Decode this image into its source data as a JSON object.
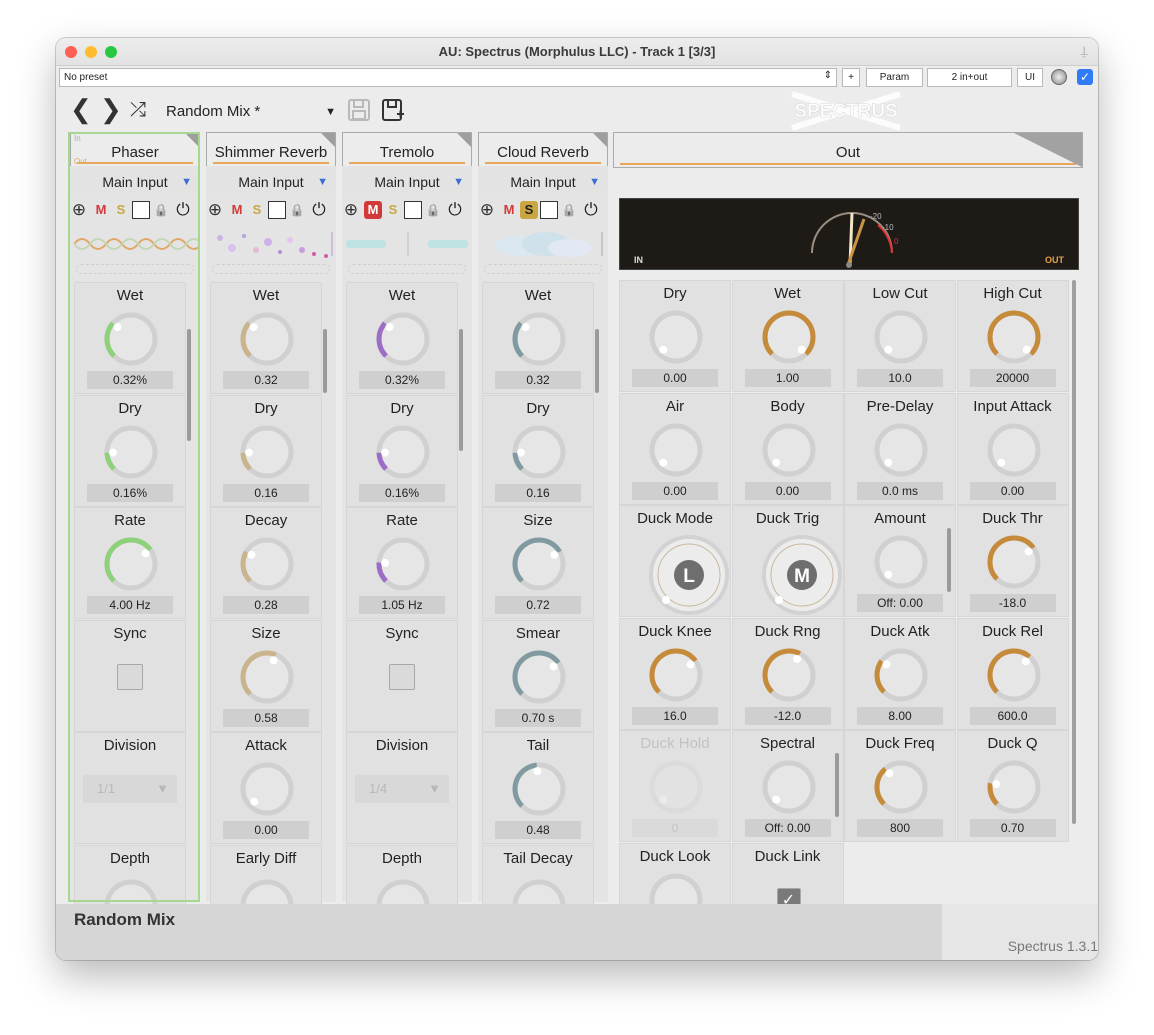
{
  "window": {
    "title": "AU: Spectrus (Morphulus LLC) - Track 1 [3/3]"
  },
  "host": {
    "preset": "No preset",
    "plus": "+",
    "param": "Param",
    "io": "2 in+out",
    "ui": "UI"
  },
  "nav": {
    "preset_name": "Random Mix *",
    "logo": "SPECTRUS"
  },
  "colors": {
    "accent": "#e8a85c",
    "green": "#8fd07a",
    "purple": "#9b6dc6",
    "teal": "#7f9ba1",
    "tan": "#c9b48e",
    "orange": "#c58a3a"
  },
  "effects": [
    {
      "name": "Phaser",
      "input": "Main Input"
    },
    {
      "name": "Shimmer Reverb",
      "input": "Main Input"
    },
    {
      "name": "Tremolo",
      "input": "Main Input"
    },
    {
      "name": "Cloud Reverb",
      "input": "Main Input"
    }
  ],
  "phaser": {
    "in": "In",
    "out": "Out",
    "params": [
      {
        "label": "Wet",
        "value": "0.32%",
        "level": 0.32
      },
      {
        "label": "Dry",
        "value": "0.16%",
        "level": 0.16
      },
      {
        "label": "Rate",
        "value": "4.00 Hz",
        "level": 0.7
      },
      {
        "label": "Sync"
      },
      {
        "label": "Division",
        "value": "1/1"
      },
      {
        "label": "Depth"
      }
    ]
  },
  "shimmer": {
    "params": [
      {
        "label": "Wet",
        "value": "0.32",
        "level": 0.32
      },
      {
        "label": "Dry",
        "value": "0.16",
        "level": 0.16
      },
      {
        "label": "Decay",
        "value": "0.28",
        "level": 0.28
      },
      {
        "label": "Size",
        "value": "0.58",
        "level": 0.58
      },
      {
        "label": "Attack",
        "value": "0.00",
        "level": 0.0
      },
      {
        "label": "Early Diff"
      }
    ]
  },
  "tremolo": {
    "params": [
      {
        "label": "Wet",
        "value": "0.32%",
        "level": 0.32
      },
      {
        "label": "Dry",
        "value": "0.16%",
        "level": 0.16
      },
      {
        "label": "Rate",
        "value": "1.05 Hz",
        "level": 0.18
      },
      {
        "label": "Sync"
      },
      {
        "label": "Division",
        "value": "1/4"
      },
      {
        "label": "Depth"
      }
    ]
  },
  "cloud": {
    "params": [
      {
        "label": "Wet",
        "value": "0.32",
        "level": 0.32
      },
      {
        "label": "Dry",
        "value": "0.16",
        "level": 0.16
      },
      {
        "label": "Size",
        "value": "0.72",
        "level": 0.72
      },
      {
        "label": "Smear",
        "value": "0.70 s",
        "level": 0.7
      },
      {
        "label": "Tail",
        "value": "0.48",
        "level": 0.48
      },
      {
        "label": "Tail Decay"
      }
    ]
  },
  "out": {
    "name": "Out",
    "meter_in": "IN",
    "meter_out": "OUT",
    "meter_marks": [
      "-20",
      "-10",
      "0"
    ],
    "params": [
      {
        "label": "Dry",
        "value": "0.00",
        "level": 0.0
      },
      {
        "label": "Wet",
        "value": "1.00",
        "level": 1.0
      },
      {
        "label": "Low Cut",
        "value": "10.0",
        "level": 0.0
      },
      {
        "label": "High Cut",
        "value": "20000",
        "level": 1.0
      },
      {
        "label": "Air",
        "value": "0.00",
        "level": 0.0
      },
      {
        "label": "Body",
        "value": "0.00",
        "level": 0.0
      },
      {
        "label": "Pre-Delay",
        "value": "0.0 ms",
        "level": 0.0
      },
      {
        "label": "Input Attack",
        "value": "0.00",
        "level": 0.0
      },
      {
        "label": "Duck Mode",
        "badge": "L"
      },
      {
        "label": "Duck Trig",
        "badge": "M"
      },
      {
        "label": "Amount",
        "value": "Off: 0.00",
        "level": 0.0
      },
      {
        "label": "Duck Thr",
        "value": "-18.0",
        "level": 0.7
      },
      {
        "label": "Duck Knee",
        "value": "16.0",
        "level": 0.7
      },
      {
        "label": "Duck Rng",
        "value": "-12.0",
        "level": 0.6
      },
      {
        "label": "Duck Atk",
        "value": "8.00",
        "level": 0.3
      },
      {
        "label": "Duck Rel",
        "value": "600.0",
        "level": 0.65
      },
      {
        "label": "Duck Hold",
        "value": "0"
      },
      {
        "label": "Spectral",
        "value": "Off: 0.00",
        "level": 0.0
      },
      {
        "label": "Duck Freq",
        "value": "800",
        "level": 0.35
      },
      {
        "label": "Duck Q",
        "value": "0.70",
        "level": 0.2
      },
      {
        "label": "Duck Look"
      },
      {
        "label": "Duck Link"
      }
    ]
  },
  "footer": {
    "preset_name": "Random Mix",
    "version": "Spectrus 1.3.1"
  }
}
